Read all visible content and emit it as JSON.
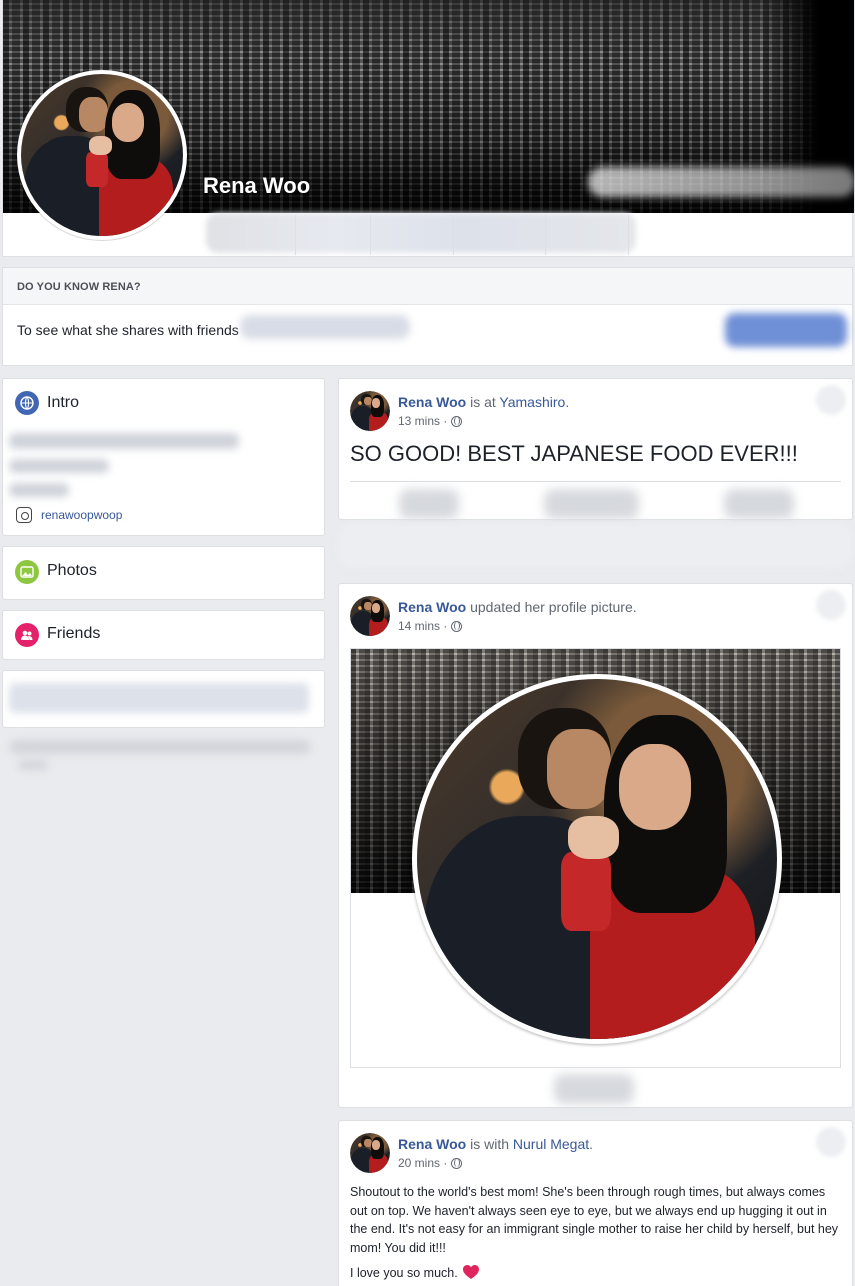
{
  "profile": {
    "name": "Rena Woo"
  },
  "know_card": {
    "heading": "DO YOU KNOW RENA?",
    "text": "To see what she shares with friends"
  },
  "sidebar": {
    "intro": {
      "title": "Intro",
      "instagram": "renawoopwoop"
    },
    "photos": {
      "title": "Photos"
    },
    "friends": {
      "title": "Friends"
    }
  },
  "posts": [
    {
      "author": "Rena Woo",
      "action": "is at",
      "place": "Yamashiro",
      "time": "13 mins",
      "text": "SO GOOD! BEST JAPANESE FOOD EVER!!!"
    },
    {
      "author": "Rena Woo",
      "action": "updated her profile picture.",
      "time": "14 mins"
    },
    {
      "author": "Rena Woo",
      "action": "is with",
      "with": "Nurul Megat",
      "time": "20 mins",
      "text": "Shoutout to the world's best mom! She's been through rough times, but always comes out on top. We haven't always seen eye to eye, but we always end up hugging it out in the end. It's not easy for an immigrant single mother to raise her child by herself, but hey mom! You did it!!!",
      "text2": "I love you so much."
    }
  ],
  "colors": {
    "link": "#385898",
    "background": "#e9ebee",
    "heart": "#e0245e"
  }
}
